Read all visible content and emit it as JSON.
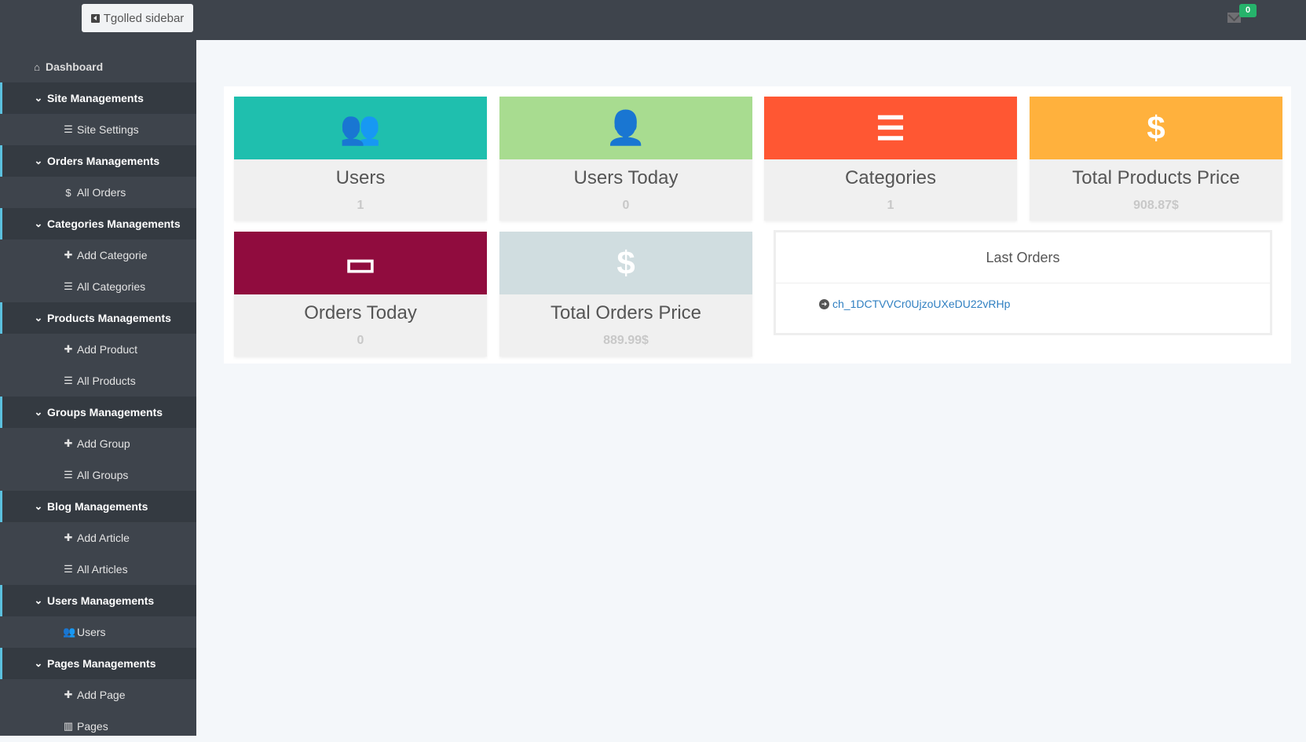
{
  "topbar": {
    "toggle_label": "Tgolled sidebar",
    "notifications": "0"
  },
  "sidebar": {
    "items": [
      {
        "label": "Dashboard",
        "type": "dash",
        "icon": "home-icon",
        "glyph": "⌂"
      },
      {
        "label": "Site Managements",
        "type": "group",
        "icon": "chevron-down-icon",
        "glyph": "⌄"
      },
      {
        "label": "Site Settings",
        "type": "sub",
        "icon": "sliders-icon",
        "glyph": "☰"
      },
      {
        "label": "Orders Managements",
        "type": "group",
        "icon": "chevron-down-icon",
        "glyph": "⌄"
      },
      {
        "label": "All Orders",
        "type": "sub",
        "icon": "hand-dollar-icon",
        "glyph": "$"
      },
      {
        "label": "Categories Managements",
        "type": "group",
        "icon": "chevron-down-icon",
        "glyph": "⌄"
      },
      {
        "label": "Add Categorie",
        "type": "sub",
        "icon": "plus-icon",
        "glyph": "✚"
      },
      {
        "label": "All Categories",
        "type": "sub",
        "icon": "list-icon",
        "glyph": "☰"
      },
      {
        "label": "Products Managements",
        "type": "group",
        "icon": "chevron-down-icon",
        "glyph": "⌄"
      },
      {
        "label": "Add Product",
        "type": "sub",
        "icon": "plus-icon",
        "glyph": "✚"
      },
      {
        "label": "All Products",
        "type": "sub",
        "icon": "list-icon",
        "glyph": "☰"
      },
      {
        "label": "Groups Managements",
        "type": "group",
        "icon": "chevron-down-icon",
        "glyph": "⌄"
      },
      {
        "label": "Add Group",
        "type": "sub",
        "icon": "plus-icon",
        "glyph": "✚"
      },
      {
        "label": "All Groups",
        "type": "sub",
        "icon": "list-icon",
        "glyph": "☰"
      },
      {
        "label": "Blog Managements",
        "type": "group",
        "icon": "chevron-down-icon",
        "glyph": "⌄"
      },
      {
        "label": "Add Article",
        "type": "sub",
        "icon": "plus-icon",
        "glyph": "✚"
      },
      {
        "label": "All Articles",
        "type": "sub",
        "icon": "list-icon",
        "glyph": "☰"
      },
      {
        "label": "Users Managements",
        "type": "group",
        "icon": "chevron-down-icon",
        "glyph": "⌄"
      },
      {
        "label": "Users",
        "type": "sub",
        "icon": "users-icon",
        "glyph": "👥"
      },
      {
        "label": "Pages Managements",
        "type": "group",
        "icon": "chevron-down-icon",
        "glyph": "⌄"
      },
      {
        "label": "Add Page",
        "type": "sub",
        "icon": "plus-icon",
        "glyph": "✚"
      },
      {
        "label": "Pages",
        "type": "sub",
        "icon": "columns-icon",
        "glyph": "▥"
      }
    ]
  },
  "cards": [
    {
      "title": "Users",
      "value": "1",
      "color": "#1fbfae",
      "icon": "users-icon",
      "glyph": "👥"
    },
    {
      "title": "Users Today",
      "value": "0",
      "color": "#a8dc90",
      "icon": "user-clock-icon",
      "glyph": "👤"
    },
    {
      "title": "Categories",
      "value": "1",
      "color": "#ff5733",
      "icon": "list-icon",
      "glyph": "☰"
    },
    {
      "title": "Total Products Price",
      "value": "908.87$",
      "color": "#ffb13d",
      "icon": "dollar-icon",
      "glyph": "$"
    },
    {
      "title": "Orders Today",
      "value": "0",
      "color": "#900c3e",
      "icon": "credit-card-icon",
      "glyph": "▭"
    },
    {
      "title": "Total Orders Price",
      "value": "889.99$",
      "color": "#d0dde0",
      "icon": "dollar-icon",
      "glyph": "$"
    }
  ],
  "last_orders": {
    "title": "Last Orders",
    "items": [
      "ch_1DCTVVCr0UjzoUXeDU22vRHp"
    ]
  }
}
